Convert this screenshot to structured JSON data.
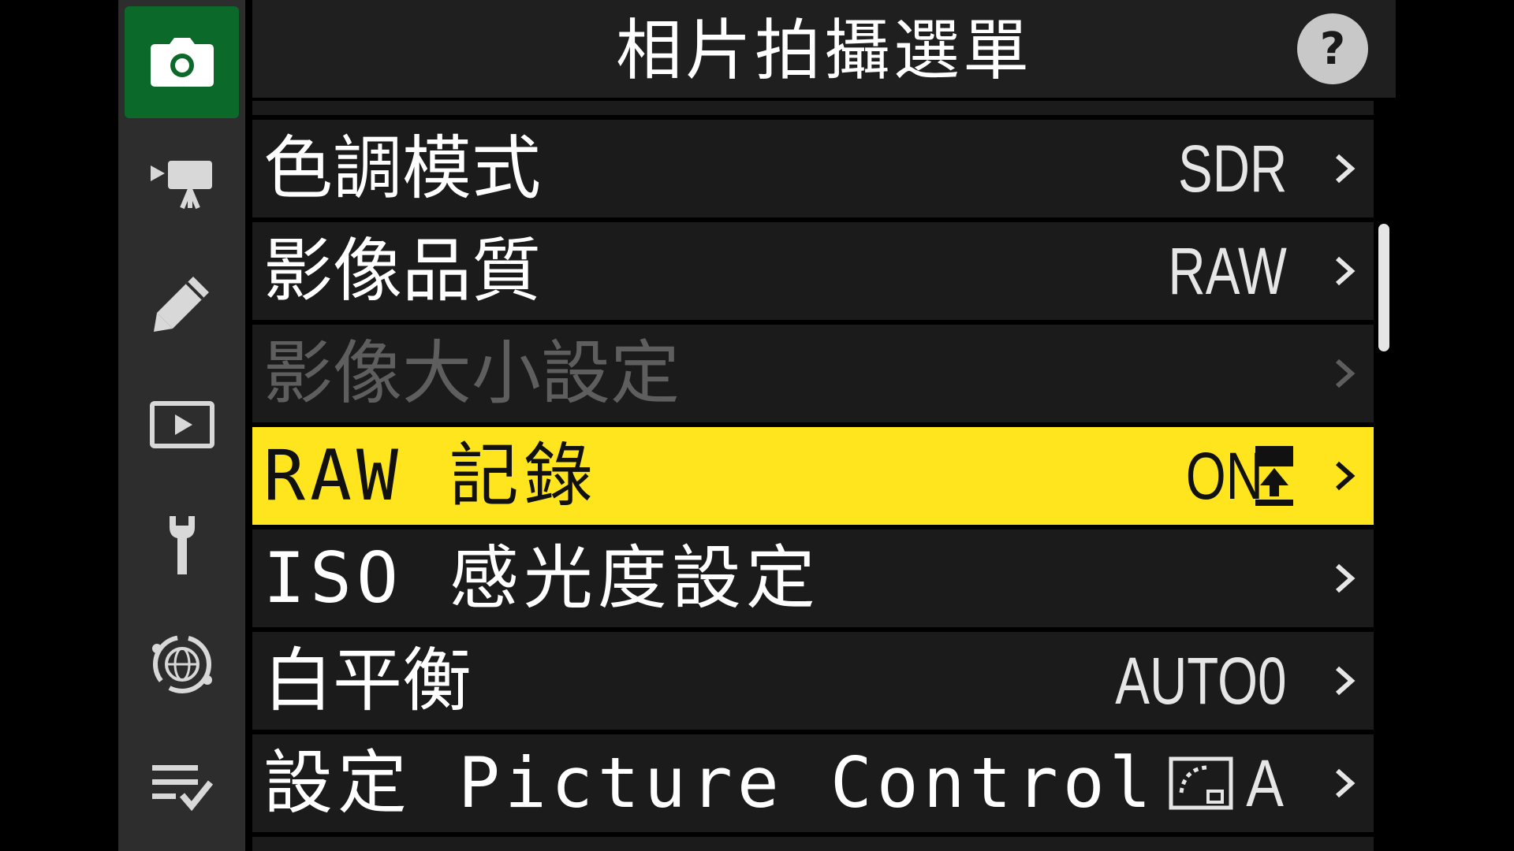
{
  "header": {
    "title": "相片拍攝選單",
    "help_label": "?"
  },
  "tabs": [
    {
      "icon": "camera-icon",
      "active": true
    },
    {
      "icon": "movie-camera-icon",
      "active": false
    },
    {
      "icon": "pencil-icon",
      "active": false
    },
    {
      "icon": "playback-icon",
      "active": false
    },
    {
      "icon": "wrench-icon",
      "active": false
    },
    {
      "icon": "network-icon",
      "active": false
    },
    {
      "icon": "my-menu-icon",
      "active": false
    }
  ],
  "menu": {
    "items": [
      {
        "label": "色調模式",
        "value": "SDR",
        "state": "normal"
      },
      {
        "label": "影像品質",
        "value": "RAW",
        "state": "normal"
      },
      {
        "label": "影像大小設定",
        "value": "",
        "state": "disabled"
      },
      {
        "label": "RAW 記錄",
        "value": "ON",
        "value_icon": "memory-card-upload-icon",
        "state": "selected"
      },
      {
        "label": "ISO 感光度設定",
        "value": "",
        "state": "normal"
      },
      {
        "label": "白平衡",
        "value": "AUTO0",
        "state": "normal"
      },
      {
        "label": "設定 Picture Control",
        "value": "A",
        "value_icon": "picture-control-icon",
        "state": "normal"
      }
    ]
  },
  "colors": {
    "active_tab": "#0b6a2a",
    "selected_row": "#ffe51e",
    "row_background": "#1b1b1b",
    "disabled_text": "#5e5e5e"
  }
}
